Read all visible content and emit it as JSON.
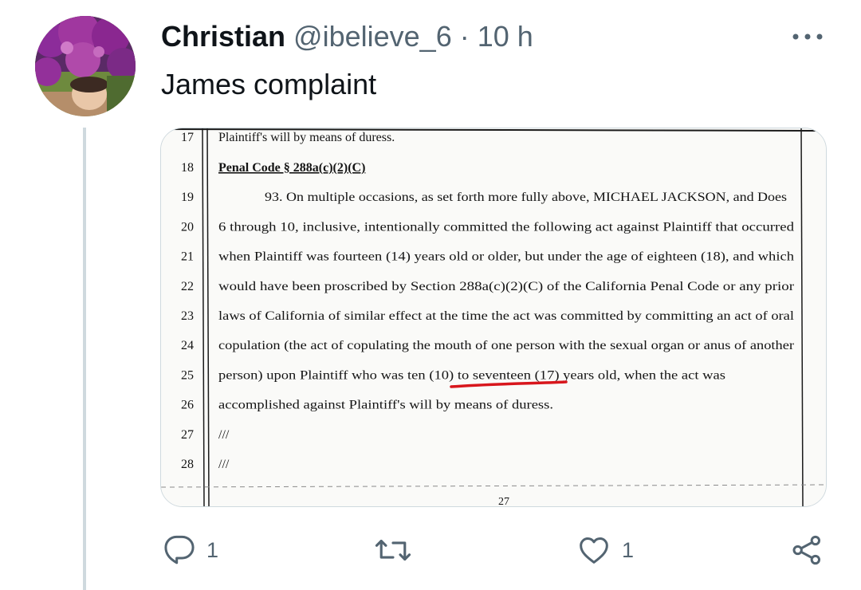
{
  "tweet": {
    "author_name": "Christian",
    "handle": "@ibelieve_6",
    "separator": "·",
    "time": "10 h",
    "text": "James complaint"
  },
  "document": {
    "page_number": "27",
    "lines": [
      {
        "num": "17",
        "text": "Plaintiff's will by means of duress."
      },
      {
        "num": "18",
        "text": "Penal Code § 288a(c)(2)(C)"
      },
      {
        "num": "19",
        "text": "93.      On multiple occasions, as set forth more fully above, MICHAEL JACKSON, and Does"
      },
      {
        "num": "20",
        "text": "6 through 10, inclusive, intentionally committed the following act against Plaintiff that occurred"
      },
      {
        "num": "21",
        "text": "when Plaintiff was fourteen (14) years old or older, but under the age of eighteen (18), and which"
      },
      {
        "num": "22",
        "text": "would have been proscribed by Section 288a(c)(2)(C) of the California Penal Code or any prior"
      },
      {
        "num": "23",
        "text": "laws of California of similar effect at the time the act was committed by committing an act of oral"
      },
      {
        "num": "24",
        "text": "copulation (the act of copulating the mouth of one person with the sexual organ or anus of another"
      },
      {
        "num": "25",
        "text": "person) upon Plaintiff who was ten (10) to seventeen (17) years old, when the act was"
      },
      {
        "num": "26",
        "text": "accomplished against Plaintiff's will by means of duress."
      },
      {
        "num": "27",
        "text": "///"
      },
      {
        "num": "28",
        "text": "///"
      }
    ],
    "highlight_color": "#d8161c"
  },
  "actions": {
    "reply_count": "1",
    "retweet_count": "",
    "like_count": "1",
    "reply_icon": "reply-icon",
    "retweet_icon": "retweet-icon",
    "like_icon": "heart-icon",
    "share_icon": "share-icon"
  },
  "colors": {
    "text_primary": "#0f1419",
    "text_secondary": "#536471",
    "border": "#cfd9de"
  }
}
